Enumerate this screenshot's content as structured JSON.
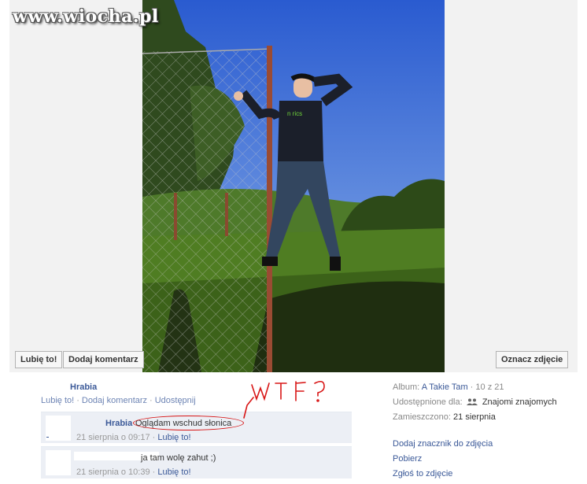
{
  "watermark": "www.wiocha.pl",
  "photo_buttons": {
    "like": "Lubię to!",
    "comment": "Dodaj komentarz",
    "tag": "Oznacz zdjęcie"
  },
  "post": {
    "author": "Hrabia",
    "actions": [
      "Lubię to!",
      "Dodaj komentarz",
      "Udostępnij"
    ]
  },
  "comments": [
    {
      "author": "Hrabia",
      "text": "Oglądam wschud słonica",
      "time": "21 sierpnia o 09:17",
      "like": "Lubię to!"
    },
    {
      "author": "",
      "text": "ja tam wolę zahut ;)",
      "time": "21 sierpnia o 10:39",
      "like": "Lubię to!"
    }
  ],
  "annotation": {
    "text": "WTF?",
    "color": "#d81616"
  },
  "sidebar": {
    "album_label": "Album:",
    "album_name": "A Takie Tam",
    "album_position": "10 z 21",
    "shared_label": "Udostępnione dla:",
    "shared_value": "Znajomi znajomych",
    "posted_label": "Zamieszczono:",
    "posted_value": "21 sierpnia",
    "links": [
      "Dodaj znacznik do zdjęcia",
      "Pobierz",
      "Zgłoś to zdjęcie"
    ]
  },
  "colors": {
    "link": "#3b5998",
    "comment_bg": "#eceff5",
    "stage_bg": "#f2f2f2",
    "sky": "#3d6ad0"
  }
}
